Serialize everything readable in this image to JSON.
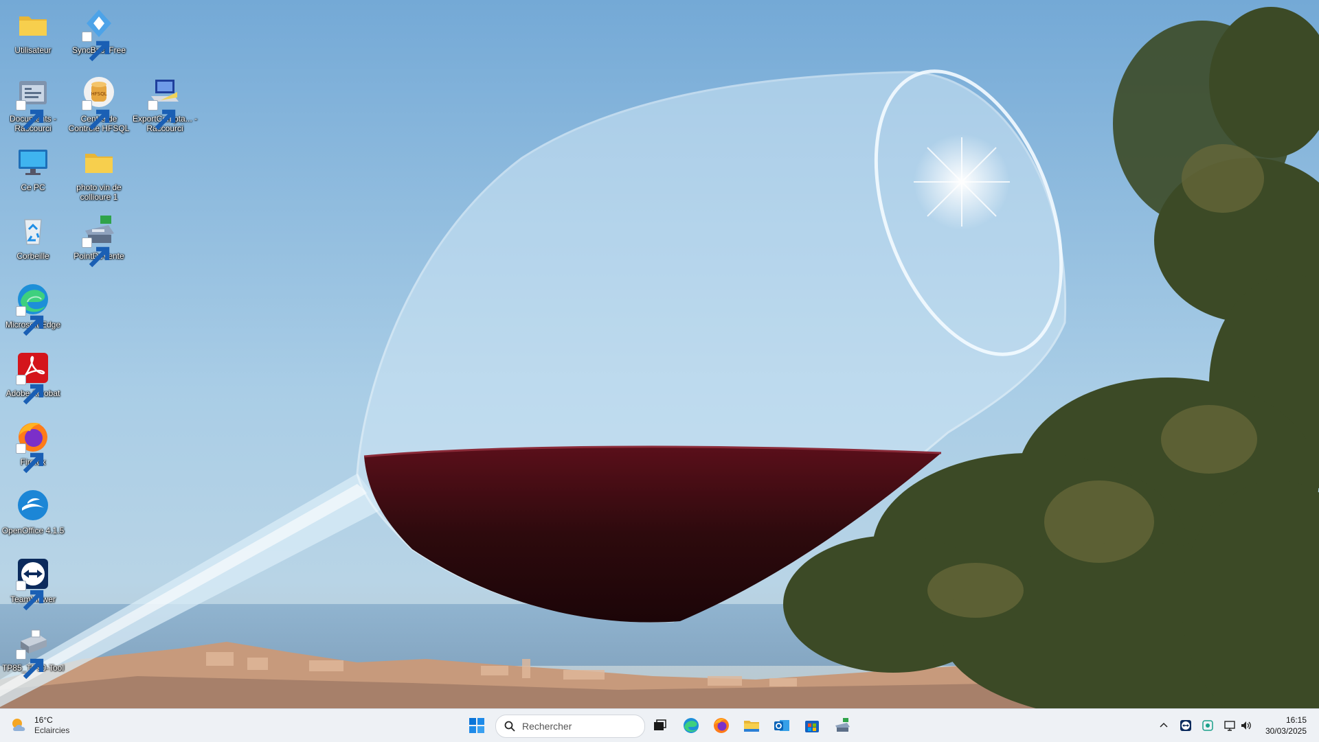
{
  "desktop": {
    "icons": [
      {
        "id": "utilisateur",
        "label": "Utilisateur",
        "icon": "folder-icon"
      },
      {
        "id": "syncbackfree",
        "label": "SyncBackFree",
        "icon": "syncback-icon"
      },
      {
        "id": "documents",
        "label": "Documents - Raccourci",
        "icon": "documents-folder-icon"
      },
      {
        "id": "hfsql",
        "label": "Centre de Contrôle HFSQL",
        "icon": "hfsql-icon"
      },
      {
        "id": "exportcompta",
        "label": "ExportCompta... - Raccourci",
        "icon": "export-compta-icon"
      },
      {
        "id": "cepc",
        "label": "Ce PC",
        "icon": "monitor-icon"
      },
      {
        "id": "photovin",
        "label": "photo vin de collioure 1",
        "icon": "folder-icon"
      },
      {
        "id": "corbeille",
        "label": "Corbeille",
        "icon": "recycle-bin-icon"
      },
      {
        "id": "pointdevente",
        "label": "PointDeVente",
        "icon": "cash-register-icon"
      },
      {
        "id": "edge",
        "label": "Microsoft Edge",
        "icon": "edge-icon"
      },
      {
        "id": "acrobat",
        "label": "Adobe Acrobat",
        "icon": "acrobat-icon"
      },
      {
        "id": "firefox",
        "label": "Firefox",
        "icon": "firefox-icon"
      },
      {
        "id": "openoffice",
        "label": "OpenOffice 4.1.5",
        "icon": "openoffice-icon"
      },
      {
        "id": "teamviewer",
        "label": "TeamViewer",
        "icon": "teamviewer-icon"
      },
      {
        "id": "tp85",
        "label": "TP85_TP90-Tool",
        "icon": "printer-icon"
      }
    ]
  },
  "taskbar": {
    "weather": {
      "temperature": "16°C",
      "condition": "Eclaircies",
      "icon": "weather-sun-cloud-icon"
    },
    "search": {
      "placeholder": "Rechercher"
    },
    "pinned": [
      "start-icon",
      "task-view-icon",
      "edge-icon",
      "firefox-icon",
      "file-explorer-icon",
      "outlook-icon",
      "store-icon",
      "cash-register-icon"
    ],
    "tray": [
      "chevron-up-icon",
      "teamviewer-tray-icon",
      "network-app-icon",
      "display-icon",
      "volume-icon"
    ],
    "clock": {
      "time": "16:15",
      "date": "30/03/2025"
    }
  },
  "colors": {
    "sky": "#8fbfe0",
    "wine": "#3b0a10",
    "taskbar": "#eef1f5",
    "accent": "#0078d4"
  }
}
